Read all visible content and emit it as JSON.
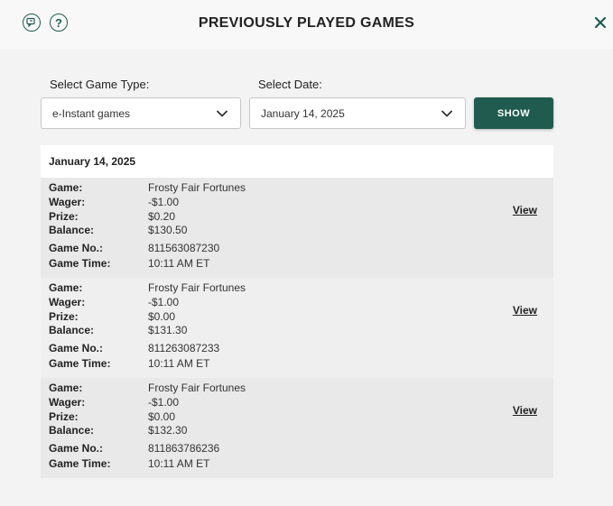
{
  "header": {
    "title": "PREVIOUSLY PLAYED GAMES"
  },
  "filters": {
    "game_type_label": "Select Game Type:",
    "game_type_value": "e-Instant games",
    "date_label": "Select Date:",
    "date_value": "January 14, 2025",
    "show_label": "SHOW"
  },
  "results": {
    "date": "January 14, 2025",
    "labels": {
      "game": "Game:",
      "wager": "Wager:",
      "prize": "Prize:",
      "balance": "Balance:",
      "game_no": "Game No.:",
      "game_time": "Game Time:",
      "view": "View"
    },
    "games": [
      {
        "name": "Frosty Fair Fortunes",
        "wager": "-$1.00",
        "prize": "$0.20",
        "balance": "$130.50",
        "game_no": "811563087230",
        "game_time": "10:11 AM ET"
      },
      {
        "name": "Frosty Fair Fortunes",
        "wager": "-$1.00",
        "prize": "$0.00",
        "balance": "$131.30",
        "game_no": "811263087233",
        "game_time": "10:11 AM ET"
      },
      {
        "name": "Frosty Fair Fortunes",
        "wager": "-$1.00",
        "prize": "$0.00",
        "balance": "$132.30",
        "game_no": "811863786236",
        "game_time": "10:11 AM ET"
      }
    ]
  },
  "colors": {
    "accent": "#1f5c4f",
    "background": "#f3f3f3"
  },
  "icons": [
    "chat-icon",
    "help-icon",
    "close-icon",
    "chevron-down-icon"
  ]
}
